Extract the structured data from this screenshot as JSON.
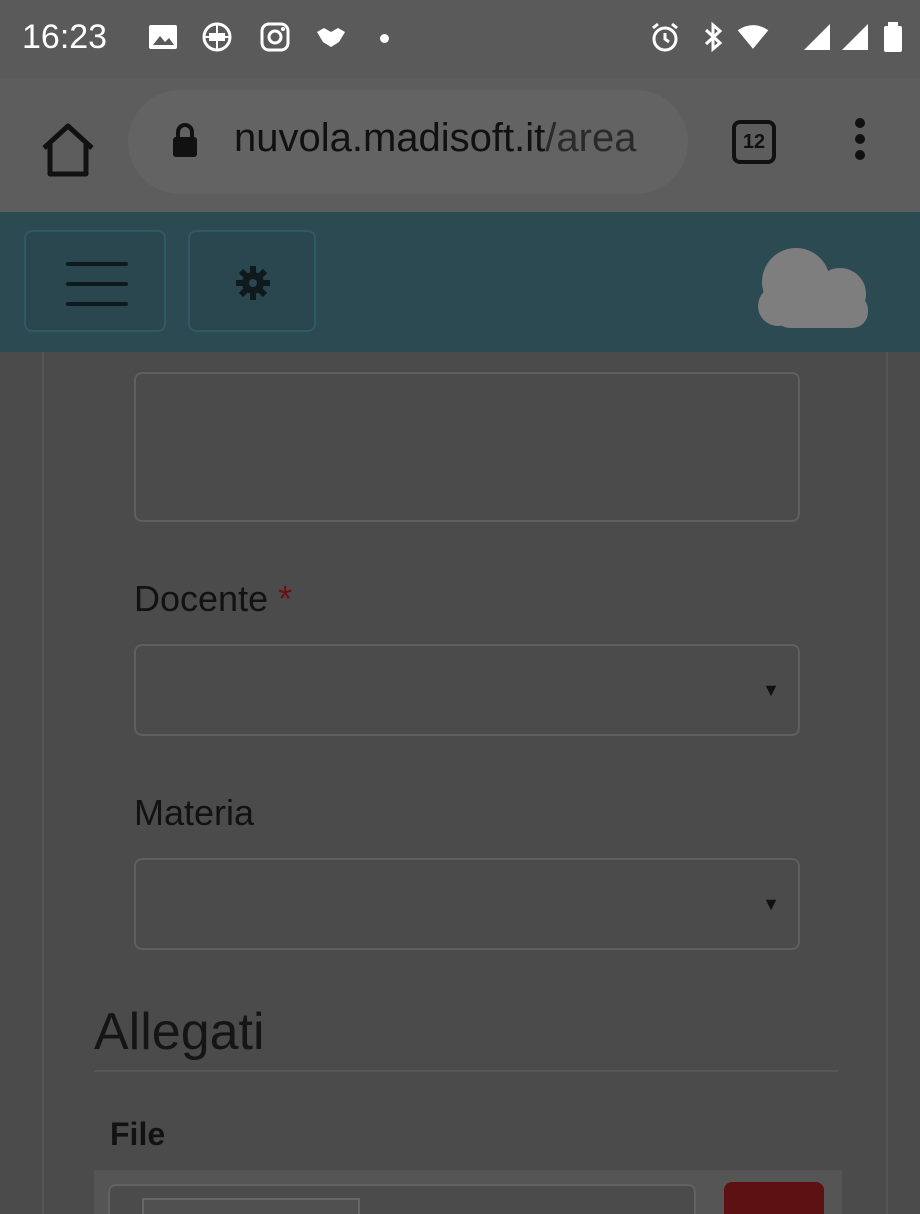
{
  "status_bar": {
    "time": "16:23",
    "left_icons": [
      "image-icon",
      "vpn-globe-icon",
      "instagram-icon",
      "handshake-icon"
    ],
    "right_icons": [
      "alarm-icon",
      "bluetooth-icon",
      "wifi-icon",
      "signal-icon",
      "signal-icon",
      "battery-icon"
    ]
  },
  "browser": {
    "url_host": "nuvola.madisoft.it",
    "url_path": "/area",
    "tab_count": "12"
  },
  "form": {
    "docente_label": "Docente",
    "required_mark": "*",
    "materia_label": "Materia",
    "docente_value": "",
    "materia_value": "",
    "caret": "▼"
  },
  "attachments": {
    "section_title": "Allegati",
    "file_label": "File"
  },
  "colors": {
    "header_teal": "#2c4a52",
    "required_red": "#6a1010",
    "remove_button": "#5c1212"
  }
}
